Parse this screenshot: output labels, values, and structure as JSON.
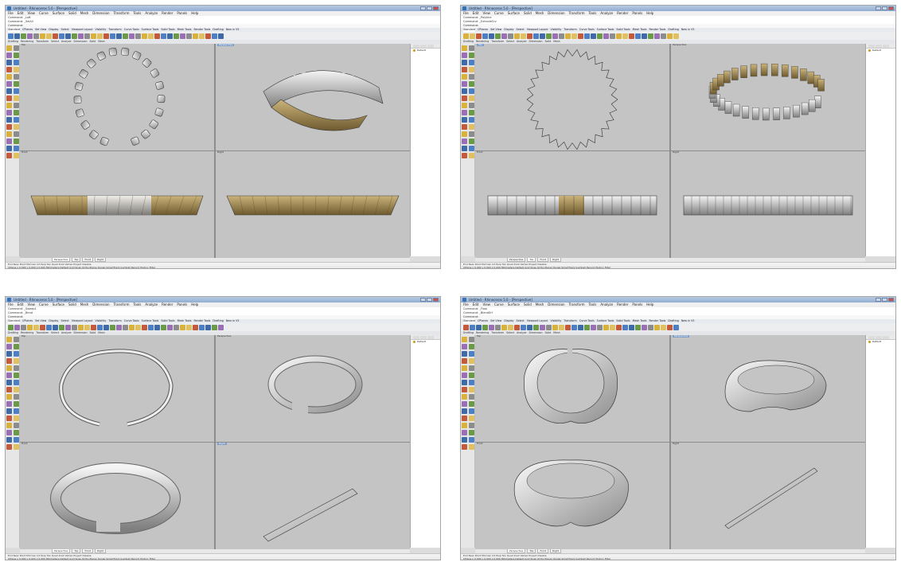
{
  "windows": [
    {
      "title": "Untitled - Rhinoceros 5.0 - [Perspective]",
      "menu": [
        "File",
        "Edit",
        "View",
        "Curve",
        "Surface",
        "Solid",
        "Mesh",
        "Dimension",
        "Transform",
        "Tools",
        "Analyze",
        "Render",
        "Panels",
        "Help"
      ],
      "command_history": [
        "Command: _Loft",
        "Command: _SelAll"
      ],
      "command_prompt": "Command:",
      "toolbar_tabs": [
        "Standard",
        "CPlanes",
        "Set View",
        "Display",
        "Select",
        "Viewport Layout",
        "Visibility",
        "Transform",
        "Curve Tools",
        "Surface Tools",
        "Solid Tools",
        "Mesh Tools",
        "Render Tools",
        "Drafting",
        "New in V5"
      ],
      "active_tab": "Standard",
      "toolbar2": [
        "Drafting",
        "Rendering",
        "Transform",
        "Select",
        "Analyze",
        "Dimension",
        "Solid",
        "Mesh"
      ],
      "viewports": [
        "Top",
        "Perspective",
        "Front",
        "Right"
      ],
      "active_viewport": "Perspective",
      "viewport_tabs": [
        "Perspective",
        "Top",
        "Front",
        "Right"
      ],
      "active_viewport_tab": "Perspective",
      "osnap": "End  Near  Point  Mid  Cen  Int  Perp  Tan  Quad  Knot  Vertex  Project  Disable",
      "status": "CPlane  x 0.000  y 0.000  z 0.000  Millimeters   Default    Grid Snap  Ortho  Planar  Osnap  SmartTrack  Gumball  Record History  Filter",
      "layers": [
        "Default"
      ],
      "model": "band-segments"
    },
    {
      "title": "Untitled - Rhinoceros 5.0 - [Perspective]",
      "menu": [
        "File",
        "Edit",
        "View",
        "Curve",
        "Surface",
        "Solid",
        "Mesh",
        "Dimension",
        "Transform",
        "Tools",
        "Analyze",
        "Render",
        "Panels",
        "Help"
      ],
      "command_history": [
        "Command: _Polyline",
        "Command: _ExtrudeCrv"
      ],
      "command_prompt": "Command:",
      "toolbar_tabs": [
        "Standard",
        "CPlanes",
        "Set View",
        "Display",
        "Select",
        "Viewport Layout",
        "Visibility",
        "Transform",
        "Curve Tools",
        "Surface Tools",
        "Solid Tools",
        "Mesh Tools",
        "Render Tools",
        "Drafting",
        "New in V5"
      ],
      "active_tab": "Standard",
      "toolbar2": [
        "Drafting",
        "Rendering",
        "Transform",
        "Select",
        "Analyze",
        "Dimension",
        "Solid",
        "Mesh"
      ],
      "viewports": [
        "Top",
        "Perspective",
        "Front",
        "Right"
      ],
      "active_viewport": "Top",
      "viewport_tabs": [
        "Perspective",
        "Top",
        "Front",
        "Right"
      ],
      "active_viewport_tab": "Top",
      "osnap": "End  Near  Point  Mid  Cen  Int  Perp  Tan  Quad  Knot  Vertex  Project  Disable",
      "status": "CPlane  x 0.000  y 0.000  z 0.000  Millimeters   Default    Grid Snap  Ortho  Planar  Osnap  SmartTrack  Gumball  Record History  Filter",
      "layers": [
        "Default"
      ],
      "model": "zigzag"
    },
    {
      "title": "Untitled - Rhinoceros 5.0 - [Perspective]",
      "menu": [
        "File",
        "Edit",
        "View",
        "Curve",
        "Surface",
        "Solid",
        "Mesh",
        "Dimension",
        "Transform",
        "Tools",
        "Analyze",
        "Render",
        "Panels",
        "Help"
      ],
      "command_history": [
        "Command: _Sweep1",
        "Command: _Bend"
      ],
      "command_prompt": "Command:",
      "toolbar_tabs": [
        "Standard",
        "CPlanes",
        "Set View",
        "Display",
        "Select",
        "Viewport Layout",
        "Visibility",
        "Transform",
        "Curve Tools",
        "Surface Tools",
        "Solid Tools",
        "Mesh Tools",
        "Render Tools",
        "Drafting",
        "New in V5"
      ],
      "active_tab": "Standard",
      "toolbar2": [
        "Drafting",
        "Rendering",
        "Transform",
        "Select",
        "Analyze",
        "Dimension",
        "Solid",
        "Mesh"
      ],
      "viewports": [
        "Top",
        "Perspective",
        "Front",
        "Right"
      ],
      "active_viewport": "Right",
      "viewport_tabs": [
        "Perspective",
        "Top",
        "Front",
        "Right"
      ],
      "active_viewport_tab": "Perspective",
      "osnap": "End  Near  Point  Mid  Cen  Int  Perp  Tan  Quad  Knot  Vertex  Project  Disable",
      "status": "CPlane  x 0.000  y 0.000  z 0.000  Millimeters   Default    Grid Snap  Ortho  Planar  Osnap  SmartTrack  Gumball  Record History  Filter",
      "layers": [
        "Default"
      ],
      "model": "cuff"
    },
    {
      "title": "Untitled - Rhinoceros 5.0 - [Perspective]",
      "menu": [
        "File",
        "Edit",
        "View",
        "Curve",
        "Surface",
        "Solid",
        "Mesh",
        "Dimension",
        "Transform",
        "Tools",
        "Analyze",
        "Render",
        "Panels",
        "Help"
      ],
      "command_history": [
        "Command: _Flow",
        "Command: _BlendSrf"
      ],
      "command_prompt": "Command:",
      "toolbar_tabs": [
        "Standard",
        "CPlanes",
        "Set View",
        "Display",
        "Select",
        "Viewport Layout",
        "Visibility",
        "Transform",
        "Curve Tools",
        "Surface Tools",
        "Solid Tools",
        "Mesh Tools",
        "Render Tools",
        "Drafting",
        "New in V5"
      ],
      "active_tab": "Standard",
      "toolbar2": [
        "Drafting",
        "Rendering",
        "Transform",
        "Select",
        "Analyze",
        "Dimension",
        "Solid",
        "Mesh"
      ],
      "viewports": [
        "Top",
        "Perspective",
        "Front",
        "Right"
      ],
      "active_viewport": "Perspective",
      "viewport_tabs": [
        "Perspective",
        "Top",
        "Front",
        "Right"
      ],
      "active_viewport_tab": "Perspective",
      "osnap": "End  Near  Point  Mid  Cen  Int  Perp  Tan  Quad  Knot  Vertex  Project  Disable",
      "status": "CPlane  x 0.000  y 0.000  z 0.000  Millimeters   Default    Grid Snap  Ortho  Planar  Osnap  SmartTrack  Gumball  Record History  Filter",
      "layers": [
        "Default"
      ],
      "model": "collar"
    }
  ],
  "colors": {
    "viewport_bg": "#c4c4c4",
    "gold": "#a4874e",
    "silver": "#e6e6e6",
    "active_title": "#7f9ec9",
    "edge": "#3a3a3a"
  }
}
